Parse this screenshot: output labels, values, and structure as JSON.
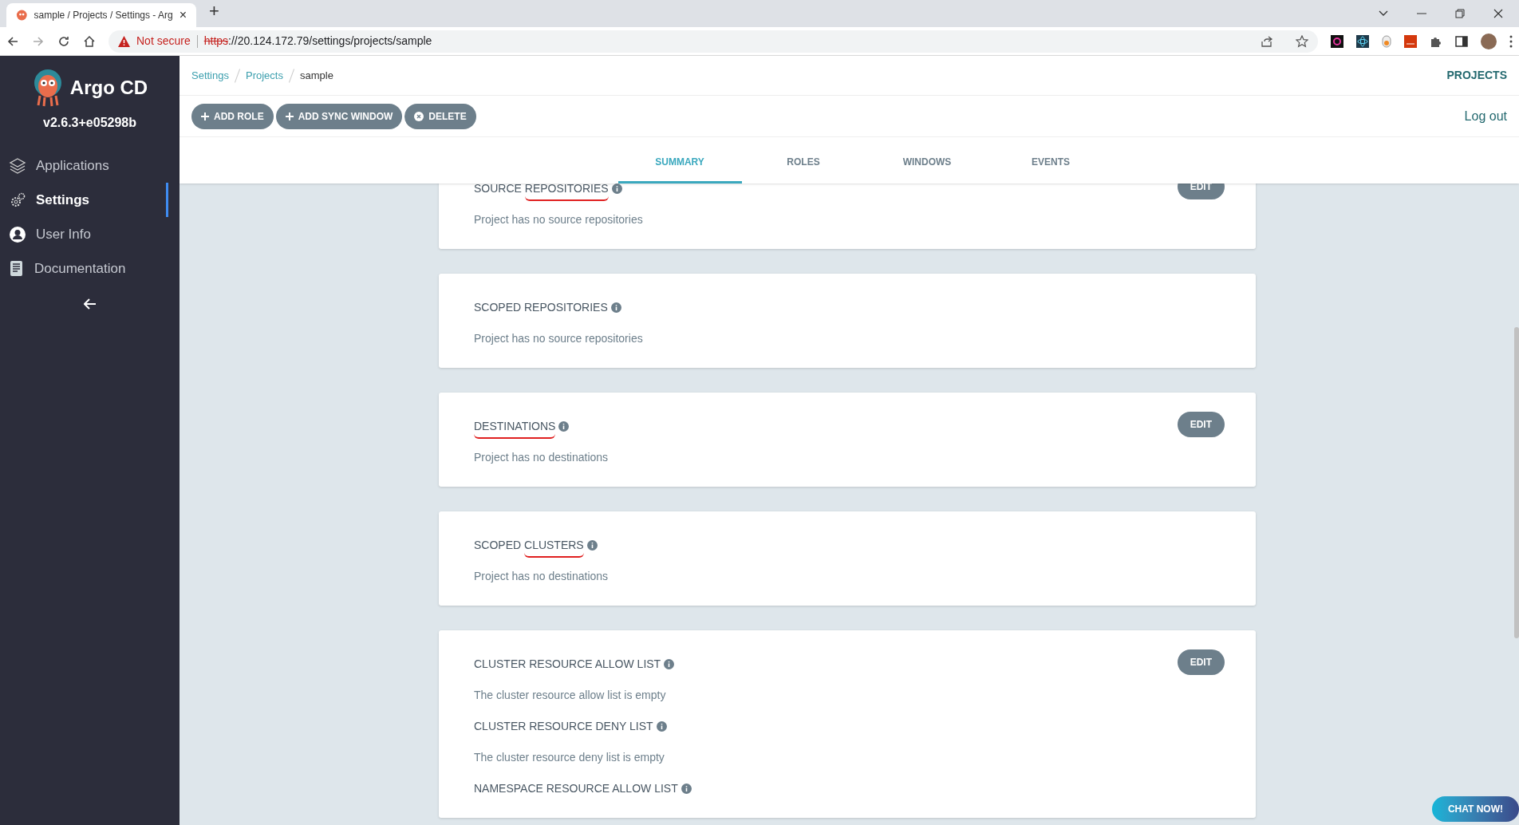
{
  "browser": {
    "tab_title": "sample / Projects / Settings - Arg",
    "tab_close": "×",
    "new_tab": "+",
    "not_secure": "Not secure",
    "url_scheme": "https",
    "url_rest": "://20.124.172.79/settings/projects/sample"
  },
  "sidebar": {
    "brand": "Argo CD",
    "version": "v2.6.3+e05298b",
    "items": [
      {
        "kind": "layers",
        "label": "Applications",
        "selected": false
      },
      {
        "kind": "gear",
        "label": "Settings",
        "selected": true
      },
      {
        "kind": "user",
        "label": "User Info",
        "selected": false
      },
      {
        "kind": "doc",
        "label": "Documentation",
        "selected": false
      }
    ]
  },
  "breadcrumbs": [
    {
      "label": "Settings",
      "link": true
    },
    {
      "label": "Projects",
      "link": true
    },
    {
      "label": "sample",
      "link": false
    }
  ],
  "top_right_link": "PROJECTS",
  "actions": [
    {
      "kind": "plus",
      "label": "ADD ROLE"
    },
    {
      "kind": "plus",
      "label": "ADD SYNC WINDOW"
    },
    {
      "kind": "delete",
      "label": "DELETE"
    }
  ],
  "logout": "Log out",
  "tabs": [
    {
      "label": "SUMMARY",
      "selected": true
    },
    {
      "label": "ROLES",
      "selected": false
    },
    {
      "label": "WINDOWS",
      "selected": false
    },
    {
      "label": "EVENTS",
      "selected": false
    }
  ],
  "cards": [
    {
      "edit": "EDIT",
      "sections": [
        {
          "title_parts": [
            {
              "text": "SOURCE ",
              "marked": false
            },
            {
              "text": "REPOSITORIES",
              "marked": true
            }
          ],
          "text": "Project has no source repositories"
        }
      ]
    },
    {
      "sections": [
        {
          "title_parts": [
            {
              "text": "SCOPED REPOSITORIES",
              "marked": false
            }
          ],
          "text": "Project has no source repositories"
        }
      ]
    },
    {
      "edit": "EDIT",
      "sections": [
        {
          "title_parts": [
            {
              "text": "DESTINATIONS",
              "marked": true
            }
          ],
          "text": "Project has no destinations"
        }
      ]
    },
    {
      "sections": [
        {
          "title_parts": [
            {
              "text": "SCOPED ",
              "marked": false
            },
            {
              "text": "CLUSTERS",
              "marked": true
            }
          ],
          "text": "Project has no destinations"
        }
      ]
    },
    {
      "edit": "EDIT",
      "sections": [
        {
          "title_parts": [
            {
              "text": "CLUSTER RESOURCE ALLOW LIST",
              "marked": false
            }
          ],
          "text": "The cluster resource allow list is empty"
        },
        {
          "title_parts": [
            {
              "text": "CLUSTER RESOURCE DENY LIST",
              "marked": false
            }
          ],
          "text": "The cluster resource deny list is empty"
        },
        {
          "title_parts": [
            {
              "text": "NAMESPACE RESOURCE ALLOW LIST",
              "marked": false
            }
          ]
        }
      ]
    }
  ],
  "chat_button": "CHAT NOW!"
}
